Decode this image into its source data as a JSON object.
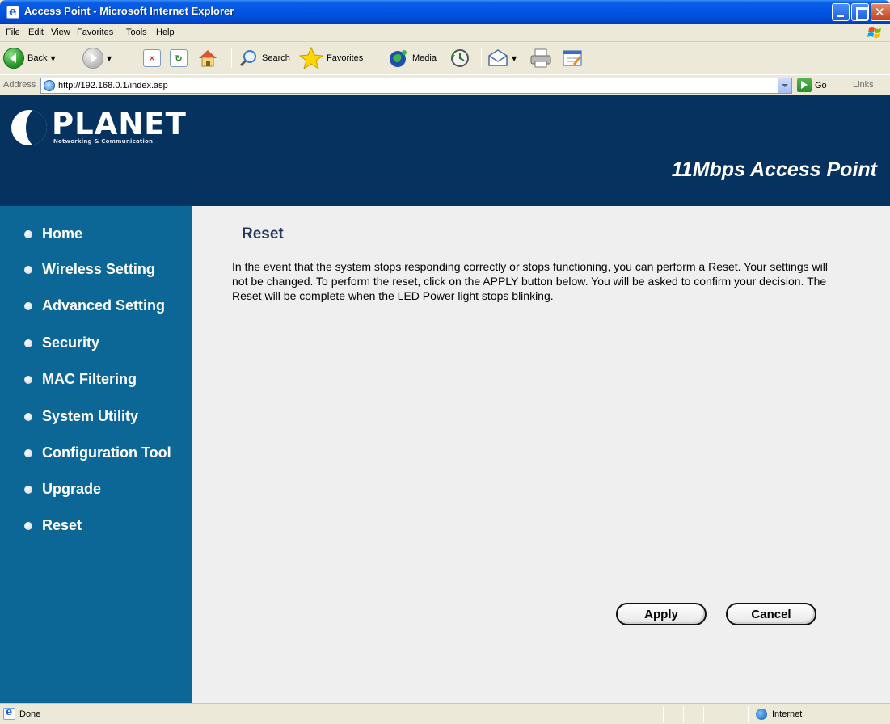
{
  "window": {
    "title": "Access Point - Microsoft Internet Explorer"
  },
  "menubar": {
    "items": [
      "File",
      "Edit",
      "View",
      "Favorites",
      "Tools",
      "Help"
    ]
  },
  "toolbar": {
    "back_label": "Back",
    "search_label": "Search",
    "favorites_label": "Favorites",
    "media_label": "Media"
  },
  "addressbar": {
    "label": "Address",
    "url": "http://192.168.0.1/index.asp",
    "go_label": "Go",
    "links_label": "Links"
  },
  "header": {
    "brand": "PLANET",
    "tagline": "Networking & Communication",
    "product": "11Mbps Access Point"
  },
  "sidebar": {
    "items": [
      {
        "label": "Home"
      },
      {
        "label": "Wireless Setting"
      },
      {
        "label": "Advanced Setting"
      },
      {
        "label": "Security"
      },
      {
        "label": "MAC Filtering"
      },
      {
        "label": "System Utility"
      },
      {
        "label": "Configuration Tool"
      },
      {
        "label": "Upgrade"
      },
      {
        "label": "Reset"
      }
    ]
  },
  "main": {
    "title": "Reset",
    "description": "In the event that the system stops responding correctly or stops functioning, you can perform a Reset. Your settings will not be changed. To perform the reset, click on the APPLY button below. You will be asked to confirm your decision. The Reset will be complete when the LED Power light stops blinking.",
    "apply_label": "Apply",
    "cancel_label": "Cancel"
  },
  "statusbar": {
    "status": "Done",
    "zone": "Internet"
  },
  "colors": {
    "header_bg": "#06325f",
    "sidebar_bg": "#0d6796",
    "content_bg": "#efefef",
    "title_color": "#243a5a"
  }
}
